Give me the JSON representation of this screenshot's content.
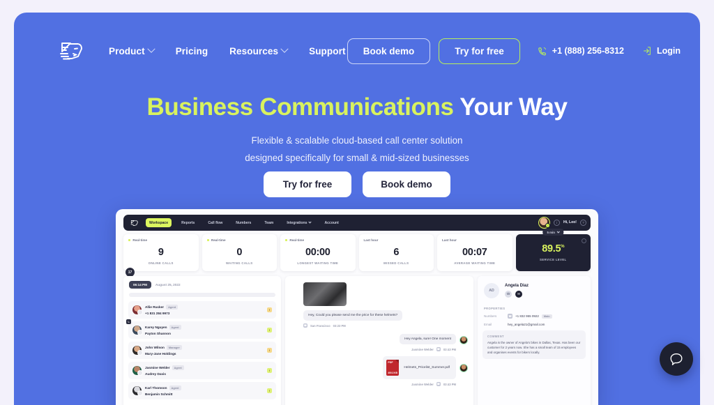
{
  "brand": {
    "logo_icon": "wolf-head-logo",
    "accent_green": "#d9f25e",
    "hero_blue": "#5170e2"
  },
  "nav": {
    "links": [
      {
        "label": "Product",
        "has_dropdown": true
      },
      {
        "label": "Pricing",
        "has_dropdown": false
      },
      {
        "label": "Resources",
        "has_dropdown": true
      },
      {
        "label": "Support",
        "has_dropdown": false
      }
    ],
    "book_demo": "Book demo",
    "try_free": "Try for free",
    "phone": "+1 (888) 256-8312",
    "phone_icon": "phone-ring-icon",
    "login": "Login",
    "login_icon": "login-arrow-icon"
  },
  "hero": {
    "title_accent": "Business Communications",
    "title_rest": " Your Way",
    "subtitle_line1": "Flexible & scalable cloud-based call center solution",
    "subtitle_line2": "designed specifically for small & mid-sized businesses",
    "cta_primary": "Try for free",
    "cta_secondary": "Book demo"
  },
  "dashboard": {
    "nav": [
      {
        "label": "Workspace",
        "active": true,
        "dropdown": false
      },
      {
        "label": "Reports",
        "active": false,
        "dropdown": false
      },
      {
        "label": "Call flow",
        "active": false,
        "dropdown": false
      },
      {
        "label": "Numbers",
        "active": false,
        "dropdown": false
      },
      {
        "label": "Team",
        "active": false,
        "dropdown": false
      },
      {
        "label": "Integrations",
        "active": false,
        "dropdown": true
      },
      {
        "label": "Account",
        "active": false,
        "dropdown": false
      }
    ],
    "greeting": "Hi, Leo!",
    "info_icon": "info-icon",
    "help_icon": "help-icon",
    "stats": [
      {
        "tag": "Real-time",
        "value": "9",
        "label": "ONLINE CALLS",
        "dark": false
      },
      {
        "tag": "Real-time",
        "value": "0",
        "label": "WAITING CALLS",
        "dark": false
      },
      {
        "tag": "Real-time",
        "value": "00:00",
        "label": "LONGEST WAITING TIME",
        "dark": false
      },
      {
        "tag": "Last hour",
        "value": "6",
        "label": "MISSED CALLS",
        "dark": false
      },
      {
        "tag": "Last hour",
        "value": "00:07",
        "label": "AVERAGE WAITING TIME",
        "dark": false
      }
    ],
    "service_level": {
      "value": "89.5",
      "unit": "%",
      "label": "SERVICE LEVEL",
      "range_chip": "5 min"
    },
    "badge_count": "17",
    "contacts_panel": {
      "time_pill": "06:14 PM",
      "date": "August 25, 2022",
      "rows": [
        {
          "name": "Allie Rucker",
          "role": "Agent",
          "sub": "+1 831 284 9973",
          "flag": "amber"
        },
        {
          "name": "Karey Nguyen",
          "role": "Agent",
          "sub": "Payton Shannon",
          "flag": "lime"
        },
        {
          "name": "John Wilson",
          "role": "Manager",
          "sub": "Mary-Jane Holdings",
          "flag": "amber"
        },
        {
          "name": "Jasmine Welder",
          "role": "Agent",
          "sub": "Audrey Davis",
          "flag": "lime"
        },
        {
          "name": "Karl Thomson",
          "role": "Agent",
          "sub": "Benjamin Schmitt",
          "flag": "lime"
        }
      ]
    },
    "chat_panel": {
      "incoming_text": "Hey, Could you please send me the price for these helmets?",
      "incoming_meta": "San Francisco",
      "incoming_time": "03:23 PM",
      "outgoing_text": "Hey Angela, sure! One moment",
      "outgoing_meta": "Jasmine Welder",
      "outgoing_time": "03:43 PM",
      "file_name": "Helmets_Pricelist_Summer.pdf",
      "file_type": "PDF",
      "file_size": "400.3 KB",
      "file_meta": "Jasmine Welder",
      "file_time": "03:43 PM"
    },
    "contact_panel": {
      "initials": "AD",
      "name": "Angela Diaz",
      "call_icon": "phone-icon",
      "message_icon": "message-icon",
      "properties_title": "PROPERTIES",
      "numbers_key": "Numbers",
      "numbers_value": "+1 832 955 0922",
      "numbers_tag": "Main",
      "email_key": "Email",
      "email_value": "hey_angela21@gmail.com",
      "comment_title": "COMMENT",
      "comment_body": "Angela is the owner of Angela's bikes in Dallas, Texas. Has been our customer for 2 years now. She has a small team of 15 employees and organises events for bikers locally."
    }
  },
  "support_widget": {
    "icon": "chat-bubble-icon"
  }
}
